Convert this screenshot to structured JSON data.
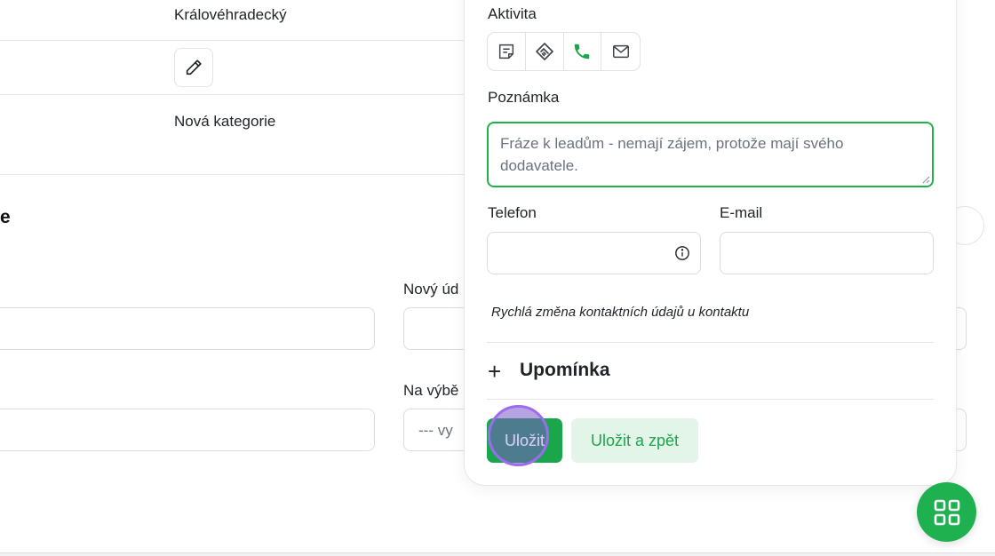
{
  "background": {
    "region_value": "Královéhradecký",
    "category_value": "Nová kategorie",
    "section_heading_fragment": "e",
    "new_field_label_fragment": "Nový úd",
    "select_label_fragment": "Na výbě",
    "select_placeholder_fragment": "--- vy"
  },
  "activity": {
    "label": "Aktivita",
    "buttons": [
      {
        "name": "note-icon"
      },
      {
        "name": "handshake-icon"
      },
      {
        "name": "phone-icon"
      },
      {
        "name": "mail-icon"
      }
    ]
  },
  "note": {
    "label": "Poznámka",
    "value": "Fráze k leadům - nemají zájem, protože mají svého dodavatele."
  },
  "phone": {
    "label": "Telefon",
    "value": ""
  },
  "email": {
    "label": "E-mail",
    "value": ""
  },
  "hint": "Rychlá změna kontaktních údajů u kontaktu",
  "reminder": {
    "plus": "+",
    "label": "Upomínka"
  },
  "actions": {
    "save": "Uložit",
    "save_back": "Uložit a zpět"
  },
  "colors": {
    "accent": "#1aa64a",
    "accent_light": "#e3f4e8",
    "cursor": "#9b6cf0"
  }
}
